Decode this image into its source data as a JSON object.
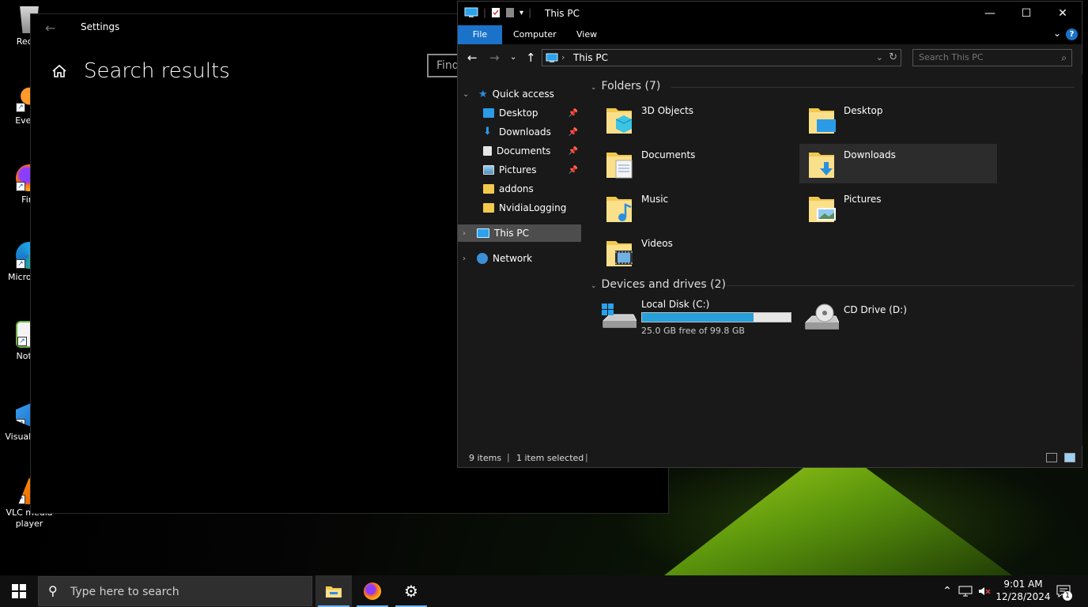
{
  "desktop": {
    "icons": [
      {
        "label": "Recyc"
      },
      {
        "label": "Everyt"
      },
      {
        "label": "Fire"
      },
      {
        "label": "Micro Edg"
      },
      {
        "label": "Notep"
      },
      {
        "label": "Visual S Co"
      },
      {
        "label": "VLC media player"
      }
    ]
  },
  "settings": {
    "title": "Settings",
    "heading": "Search results",
    "find_placeholder": "Find"
  },
  "explorer": {
    "title": "This PC",
    "ribbon_tabs": [
      "File",
      "Computer",
      "View"
    ],
    "address": "This PC",
    "search_placeholder": "Search This PC",
    "nav": {
      "quick_access": "Quick access",
      "items": [
        "Desktop",
        "Downloads",
        "Documents",
        "Pictures",
        "addons",
        "NvidiaLogging"
      ],
      "this_pc": "This PC",
      "network": "Network"
    },
    "folders_header": "Folders (7)",
    "folders": [
      "3D Objects",
      "Desktop",
      "Documents",
      "Downloads",
      "Music",
      "Pictures",
      "Videos"
    ],
    "drives_header": "Devices and drives (2)",
    "drives": [
      {
        "name": "Local Disk (C:)",
        "free": "25.0 GB free of 99.8 GB",
        "used_fraction": 0.75
      },
      {
        "name": "CD Drive (D:)"
      }
    ],
    "status": {
      "items": "9 items",
      "selected": "1 item selected"
    }
  },
  "taskbar": {
    "search_placeholder": "Type here to search",
    "time": "9:01 AM",
    "date": "12/28/2024",
    "notification_count": "1"
  },
  "colors": {
    "accent": "#1a73c9",
    "drive_fill": "#26a0da",
    "folder": "#f2c94c"
  }
}
